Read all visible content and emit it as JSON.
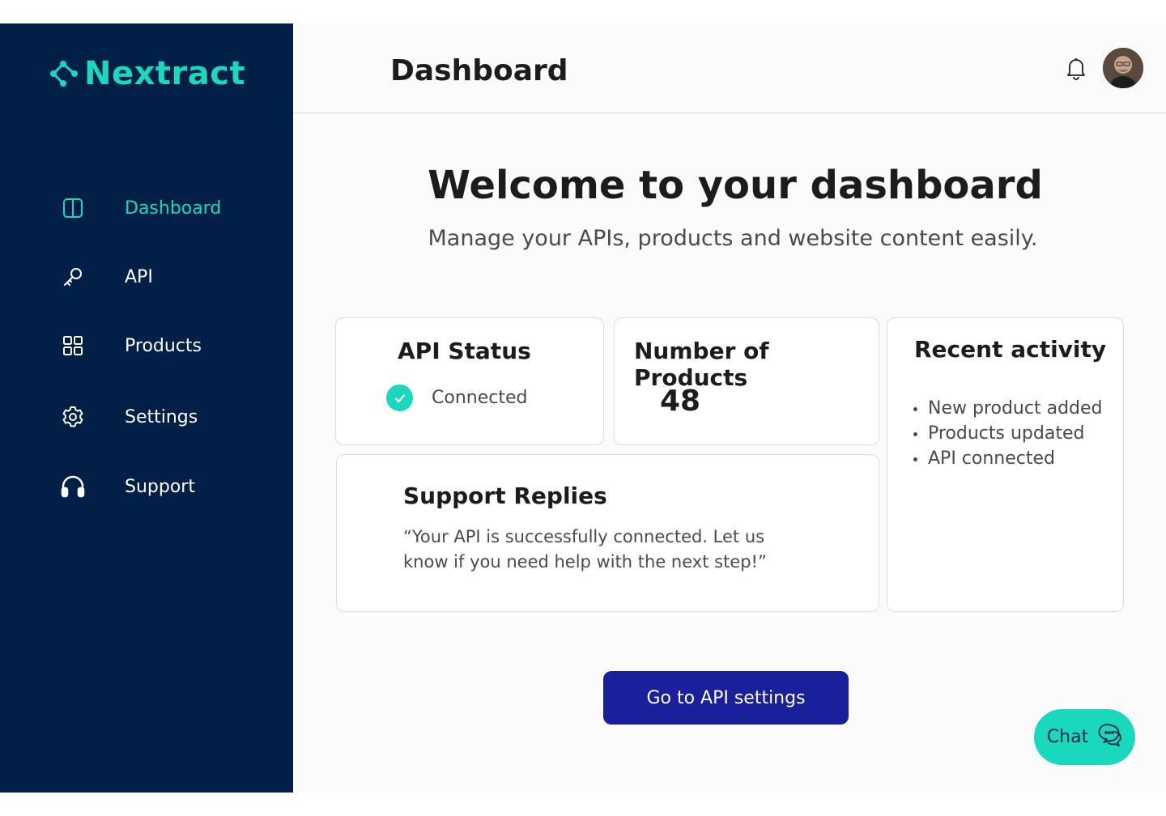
{
  "brand": {
    "name": "Nextract",
    "accent": "#1ad8bd",
    "sidebar_bg": "#021f47",
    "cta_bg": "#1a1f9c"
  },
  "sidebar": {
    "items": [
      {
        "label": "Dashboard",
        "icon": "sidebar-panel-icon",
        "active": true
      },
      {
        "label": "API",
        "icon": "key-icon",
        "active": false
      },
      {
        "label": "Products",
        "icon": "grid-icon",
        "active": false
      },
      {
        "label": "Settings",
        "icon": "gear-icon",
        "active": false
      },
      {
        "label": "Support",
        "icon": "headphones-icon",
        "active": false
      }
    ]
  },
  "header": {
    "title": "Dashboard",
    "notification_icon": "bell-icon",
    "avatar_icon": "user-avatar"
  },
  "main": {
    "welcome": "Welcome to your dashboard",
    "subtitle": "Manage your APIs, products and website content easily."
  },
  "cards": {
    "api_status": {
      "title": "API Status",
      "status": "Connected",
      "status_icon": "check-circle-icon"
    },
    "products": {
      "title": "Number of Products",
      "count": "48"
    },
    "activity": {
      "title": "Recent activity",
      "items": [
        "New product added",
        "Products updated",
        "API connected"
      ]
    },
    "support": {
      "title": "Support Replies",
      "message": "“Your API is successfully connected. Let us know if you need help with the next step!”"
    }
  },
  "actions": {
    "cta_label": "Go to API settings",
    "chat_label": "Chat",
    "chat_icon": "chat-bubbles-icon"
  }
}
